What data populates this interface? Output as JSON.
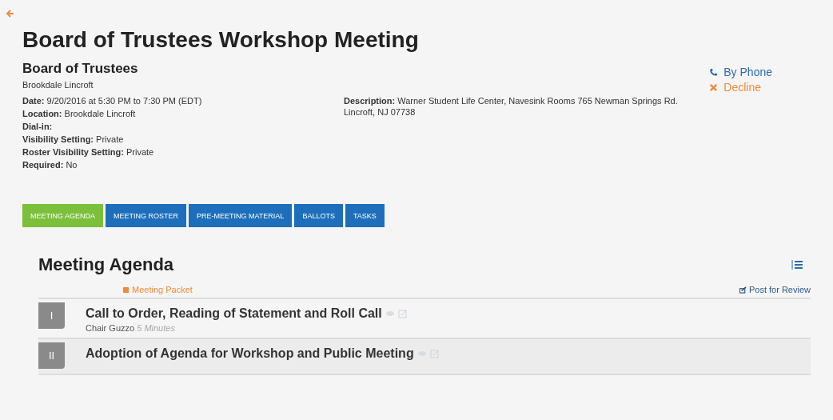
{
  "title": "Board of Trustees Workshop Meeting",
  "group": "Board of Trustees",
  "organization": "Brookdale Lincroft",
  "details": [
    {
      "label": "Date:",
      "value": "9/20/2016 at 5:30 PM to 7:30 PM (EDT)"
    },
    {
      "label": "Location:",
      "value": "Brookdale Lincroft"
    },
    {
      "label": "Dial-in:"
    },
    {
      "label": "Visibility Setting:",
      "value": "Private"
    },
    {
      "label": "Roster Visibility Setting:",
      "value": "Private"
    },
    {
      "label": "Required:",
      "value": "No"
    }
  ],
  "description": {
    "label": "Description:",
    "value": "Warner Student Life Center, Navesink Rooms 765 Newman Springs Rd. Lincroft, NJ 07738"
  },
  "actions": [
    {
      "kind": "phone",
      "label": "By Phone"
    },
    {
      "kind": "decline",
      "label": "Decline"
    }
  ],
  "tabs": [
    {
      "label": "MEETING AGENDA",
      "selected": true
    },
    {
      "label": "MEETING ROSTER",
      "selected": false
    },
    {
      "label": "PRE-MEETING MATERIAL",
      "selected": false
    },
    {
      "label": "BALLOTS",
      "selected": false
    },
    {
      "label": "TASKS",
      "selected": false
    }
  ],
  "agenda": {
    "heading": "Meeting Agenda",
    "packet": "Meeting Packet",
    "post": "Post for Review",
    "items": [
      {
        "numeral": "I",
        "title": "Call to Order, Reading of Statement and Roll Call",
        "presenter": "Chair Guzzo",
        "duration": "5 Minutes"
      },
      {
        "numeral": "II",
        "title": "Adoption of Agenda for Workshop and Public Meeting"
      }
    ]
  }
}
